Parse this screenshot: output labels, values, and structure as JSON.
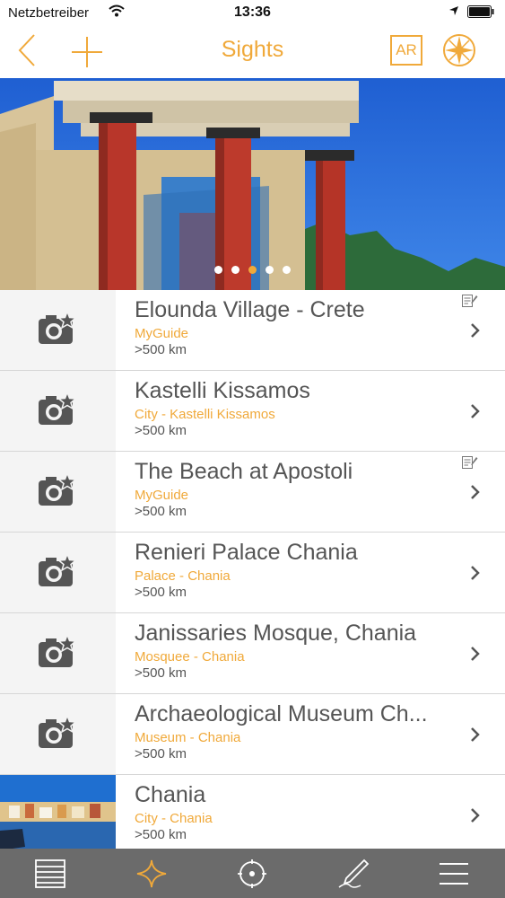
{
  "status_bar": {
    "carrier": "Netzbetreiber",
    "time": "13:36"
  },
  "nav": {
    "title": "Sights",
    "ar_label": "AR"
  },
  "hero": {
    "page_count": 5,
    "active_page": 3
  },
  "colors": {
    "accent": "#f0a93a",
    "text": "#555555",
    "tabbar": "#6b6b6b"
  },
  "sights": [
    {
      "title": "Elounda Village - Crete",
      "subtitle": "MyGuide",
      "distance": ">500 km",
      "icon": "camera-star-icon",
      "has_note": true
    },
    {
      "title": "Kastelli Kissamos",
      "subtitle": "City - Kastelli Kissamos",
      "distance": ">500 km",
      "icon": "camera-star-icon",
      "has_note": false
    },
    {
      "title": "The Beach at Apostoli",
      "subtitle": "MyGuide",
      "distance": ">500 km",
      "icon": "camera-star-icon",
      "has_note": true
    },
    {
      "title": "Renieri Palace Chania",
      "subtitle": "Palace - Chania",
      "distance": ">500 km",
      "icon": "camera-star-icon",
      "has_note": false
    },
    {
      "title": "Janissaries Mosque, Chania",
      "subtitle": "Mosquee - Chania",
      "distance": ">500 km",
      "icon": "camera-star-icon",
      "has_note": false
    },
    {
      "title": "Archaeological Museum Ch...",
      "subtitle": "Museum - Chania",
      "distance": ">500 km",
      "icon": "camera-star-icon",
      "has_note": false
    },
    {
      "title": "Chania",
      "subtitle": "City - Chania",
      "distance": ">500 km",
      "icon": "photo-thumbnail",
      "has_note": false
    }
  ],
  "tabs": [
    {
      "icon": "list-icon",
      "active": false
    },
    {
      "icon": "star-icon",
      "active": true
    },
    {
      "icon": "location-target-icon",
      "active": false
    },
    {
      "icon": "pen-icon",
      "active": false
    },
    {
      "icon": "menu-icon",
      "active": false
    }
  ]
}
